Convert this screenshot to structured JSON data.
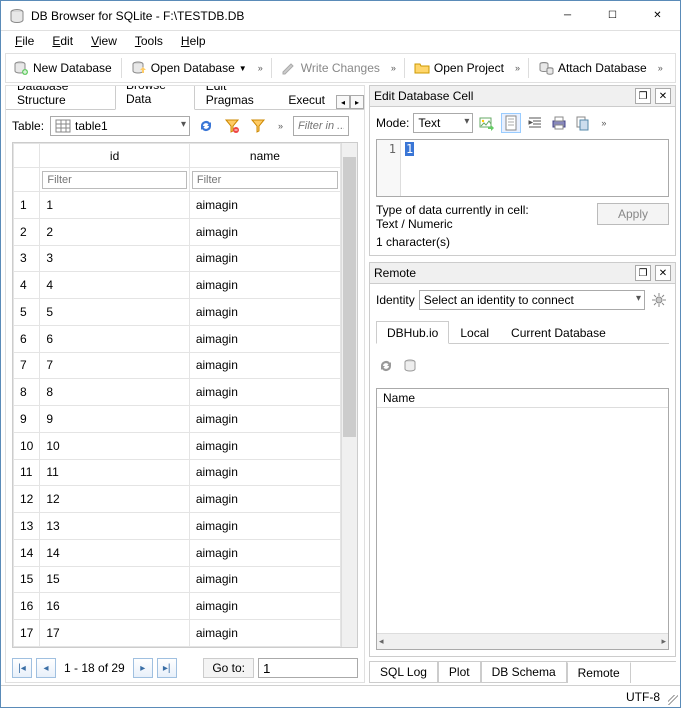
{
  "window": {
    "title": "DB Browser for SQLite - F:\\TESTDB.DB"
  },
  "menu": {
    "file": "File",
    "edit": "Edit",
    "view": "View",
    "tools": "Tools",
    "help": "Help"
  },
  "toolbar": {
    "new_db": "New Database",
    "open_db": "Open Database",
    "write_changes": "Write Changes",
    "open_project": "Open Project",
    "attach_db": "Attach Database"
  },
  "left_tabs": {
    "db_structure": "Database Structure",
    "browse_data": "Browse Data",
    "edit_pragmas": "Edit Pragmas",
    "execute": "Execut"
  },
  "table_select": {
    "label": "Table:",
    "value": "table1"
  },
  "filter_placeholder": "Filter in ...",
  "columns": {
    "id": "id",
    "name": "name"
  },
  "col_filter_placeholder": "Filter",
  "rows": [
    {
      "n": "1",
      "id": "1",
      "name": "aimagin"
    },
    {
      "n": "2",
      "id": "2",
      "name": "aimagin"
    },
    {
      "n": "3",
      "id": "3",
      "name": "aimagin"
    },
    {
      "n": "4",
      "id": "4",
      "name": "aimagin"
    },
    {
      "n": "5",
      "id": "5",
      "name": "aimagin"
    },
    {
      "n": "6",
      "id": "6",
      "name": "aimagin"
    },
    {
      "n": "7",
      "id": "7",
      "name": "aimagin"
    },
    {
      "n": "8",
      "id": "8",
      "name": "aimagin"
    },
    {
      "n": "9",
      "id": "9",
      "name": "aimagin"
    },
    {
      "n": "10",
      "id": "10",
      "name": "aimagin"
    },
    {
      "n": "11",
      "id": "11",
      "name": "aimagin"
    },
    {
      "n": "12",
      "id": "12",
      "name": "aimagin"
    },
    {
      "n": "13",
      "id": "13",
      "name": "aimagin"
    },
    {
      "n": "14",
      "id": "14",
      "name": "aimagin"
    },
    {
      "n": "15",
      "id": "15",
      "name": "aimagin"
    },
    {
      "n": "16",
      "id": "16",
      "name": "aimagin"
    },
    {
      "n": "17",
      "id": "17",
      "name": "aimagin"
    }
  ],
  "pager": {
    "range": "1 - 18 of 29",
    "goto_label": "Go to:",
    "goto_value": "1"
  },
  "edit_cell": {
    "title": "Edit Database Cell",
    "mode_label": "Mode:",
    "mode_value": "Text",
    "line": "1",
    "content": "1",
    "type_text": "Type of data currently in cell: Text / Numeric",
    "char_count": "1 character(s)",
    "apply": "Apply"
  },
  "remote": {
    "title": "Remote",
    "identity_label": "Identity",
    "identity_value": "Select an identity to connect",
    "tab_dbhub": "DBHub.io",
    "tab_local": "Local",
    "tab_current": "Current Database",
    "col_name": "Name"
  },
  "bottom_tabs": {
    "sql_log": "SQL Log",
    "plot": "Plot",
    "db_schema": "DB Schema",
    "remote": "Remote"
  },
  "status": {
    "encoding": "UTF-8"
  }
}
